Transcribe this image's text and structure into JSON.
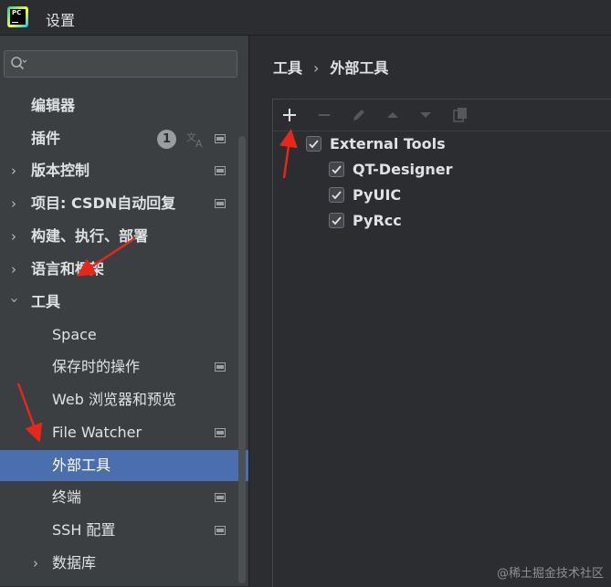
{
  "window": {
    "title": "设置"
  },
  "sidebar": {
    "search": {
      "placeholder": ""
    },
    "items": [
      {
        "label": "编辑器"
      },
      {
        "label": "插件",
        "badge": "1"
      },
      {
        "label": "版本控制"
      },
      {
        "label": "项目: CSDN自动回复"
      },
      {
        "label": "构建、执行、部署"
      },
      {
        "label": "语言和框架"
      },
      {
        "label": "工具"
      },
      {
        "label": "Space"
      },
      {
        "label": "保存时的操作"
      },
      {
        "label": "Web 浏览器和预览"
      },
      {
        "label": "File Watcher"
      },
      {
        "label": "外部工具"
      },
      {
        "label": "终端"
      },
      {
        "label": "SSH 配置"
      },
      {
        "label": "数据库"
      }
    ]
  },
  "main": {
    "breadcrumb": {
      "parent": "工具",
      "current": "外部工具"
    },
    "toolbar": {
      "buttons": [
        "add-icon",
        "remove-icon",
        "edit-icon",
        "move-up-icon",
        "move-down-icon",
        "copy-icon"
      ]
    },
    "tree": {
      "group": {
        "label": "External Tools",
        "checked": true
      },
      "children": [
        {
          "label": "QT-Designer",
          "checked": true
        },
        {
          "label": "PyUIC",
          "checked": true
        },
        {
          "label": "PyRcc",
          "checked": true
        }
      ]
    }
  },
  "watermark": "@稀土掘金技术社区",
  "colors": {
    "selection": "#4b6eaf",
    "annotation_arrow": "#e8261c",
    "background": "#2b2d30",
    "sidebar": "#3c3f41"
  }
}
